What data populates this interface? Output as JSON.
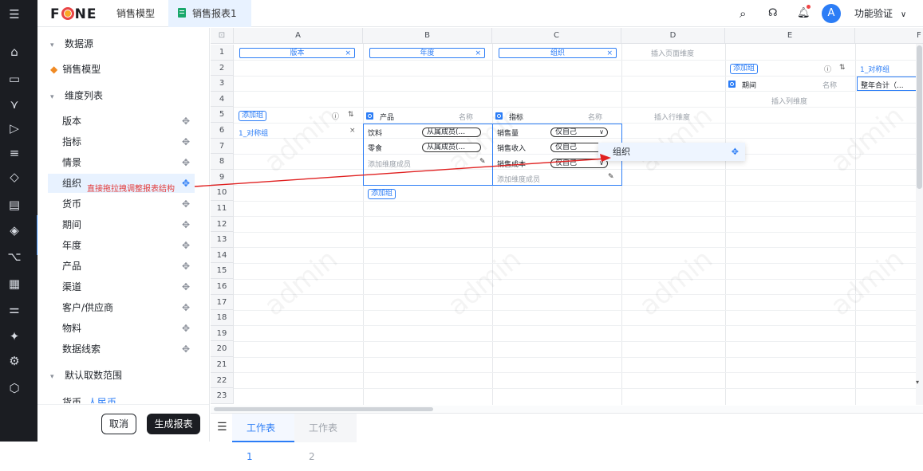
{
  "topbar": {
    "logo": "FONE",
    "tabs": [
      {
        "label": "销售模型"
      },
      {
        "label": "销售报表1"
      }
    ],
    "avatar": "A",
    "user": "功能验证"
  },
  "sidebar": {
    "groups": [
      "数据源",
      "维度列表",
      "默认取数范围"
    ],
    "model": "销售模型",
    "dimensions": [
      "版本",
      "指标",
      "情景",
      "组织",
      "货币",
      "期间",
      "年度",
      "产品",
      "渠道",
      "客户/供应商",
      "物料",
      "数据线索"
    ],
    "selected": "组织",
    "hint": "直接拖拉拽调整报表结构",
    "partial_row": {
      "label": "货币",
      "value": "人民币"
    },
    "cancel": "取消",
    "generate": "生成报表"
  },
  "grid": {
    "columns": [
      "A",
      "B",
      "C",
      "D",
      "E",
      "F"
    ],
    "rows": [
      "1",
      "2",
      "3",
      "4",
      "5",
      "6",
      "7",
      "8",
      "9",
      "10",
      "11",
      "12",
      "13",
      "14",
      "15",
      "16",
      "17",
      "18",
      "19",
      "20",
      "21",
      "22",
      "23"
    ],
    "page_dims": [
      "版本",
      "年度",
      "组织"
    ],
    "insert_page_dim": "插入页面维度",
    "insert_col_dim": "插入列维度",
    "insert_row_dim": "插入行维度",
    "add_group": "添加组",
    "group_name": "1_对称组",
    "name_label": "名称",
    "col_dim": "期间",
    "col_member": "整年合计（...",
    "row_dims": [
      "产品",
      "指标"
    ],
    "product_members": [
      {
        "name": "饮料",
        "mode": "从属成员(..."
      },
      {
        "name": "零食",
        "mode": "从属成员(..."
      }
    ],
    "metric_members": [
      {
        "name": "销售量",
        "mode": "仅自己"
      },
      {
        "name": "销售收入",
        "mode": "仅自己"
      },
      {
        "name": "销售成本",
        "mode": "仅自己"
      }
    ],
    "add_member": "添加维度成员"
  },
  "drag_popup": {
    "label": "组织"
  },
  "sheets": [
    {
      "label": "工作表1"
    },
    {
      "label": "工作表2"
    }
  ],
  "watermark": "admin",
  "colors": {
    "accent": "#2c7df6",
    "dark": "#1b1d22",
    "arrow": "#e02020"
  }
}
